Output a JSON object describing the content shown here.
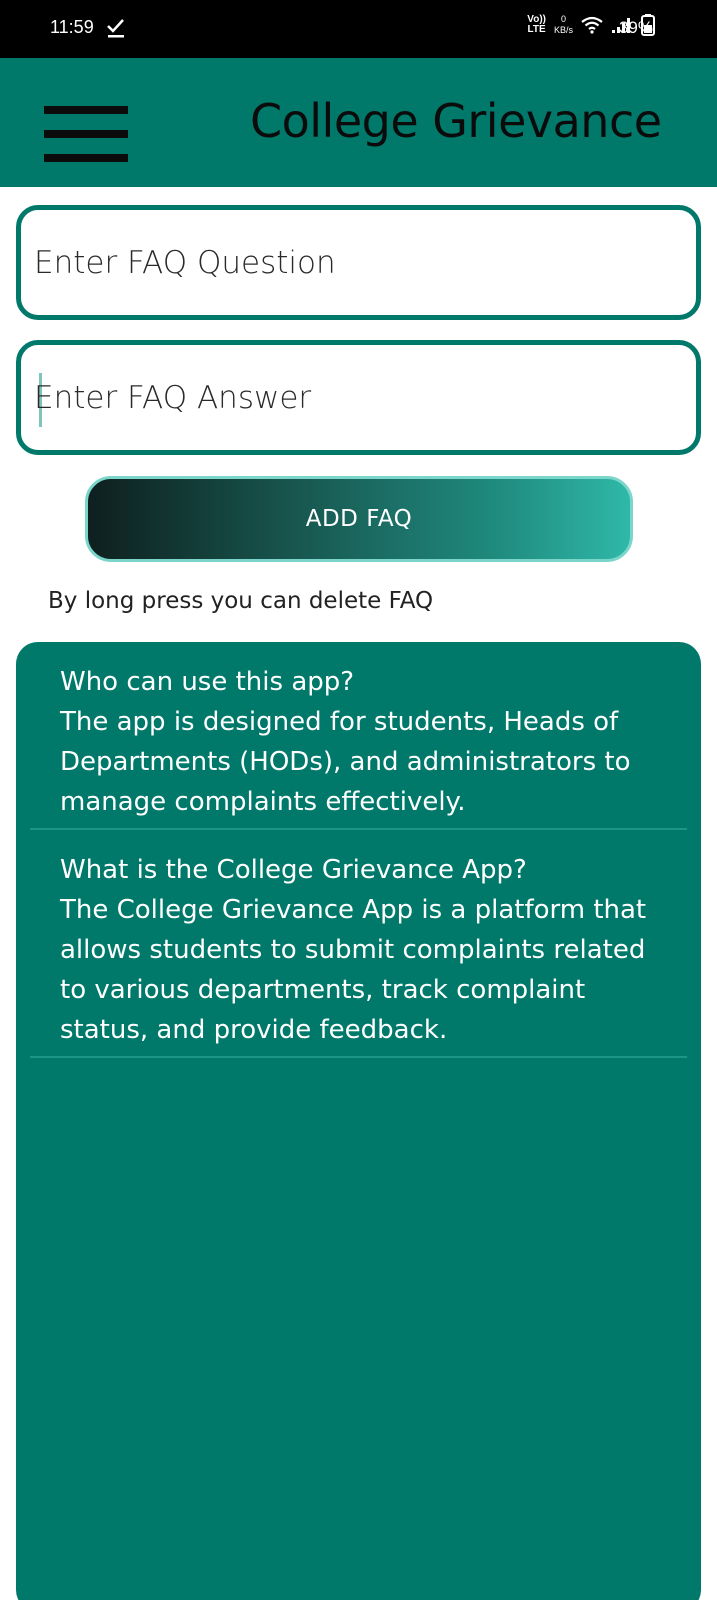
{
  "status_bar": {
    "time": "11:59",
    "volte": "Vo)) LTE",
    "net_speed_value": "0",
    "net_speed_unit": "KB/s",
    "battery_percent": "39%"
  },
  "app_bar": {
    "title": "College Grievance",
    "menu_icon": "hamburger-menu-icon"
  },
  "form": {
    "question_placeholder": "Enter FAQ Question",
    "answer_placeholder": "Enter FAQ Answer",
    "add_button_label": "ADD FAQ"
  },
  "hint": "By long press you can delete FAQ",
  "faqs": [
    {
      "question": "Who can use this app?",
      "answer": "The app is designed for students, Heads of Departments (HODs), and administrators to manage complaints effectively."
    },
    {
      "question": "What is the College Grievance App?",
      "answer": "The College Grievance App is a platform that allows students to submit complaints related to various departments, track complaint status, and provide feedback."
    }
  ],
  "colors": {
    "primary": "#00796b",
    "status_bar": "#000000",
    "button_gradient_start": "#0e1f1e",
    "button_gradient_end": "#2fb8a8"
  }
}
